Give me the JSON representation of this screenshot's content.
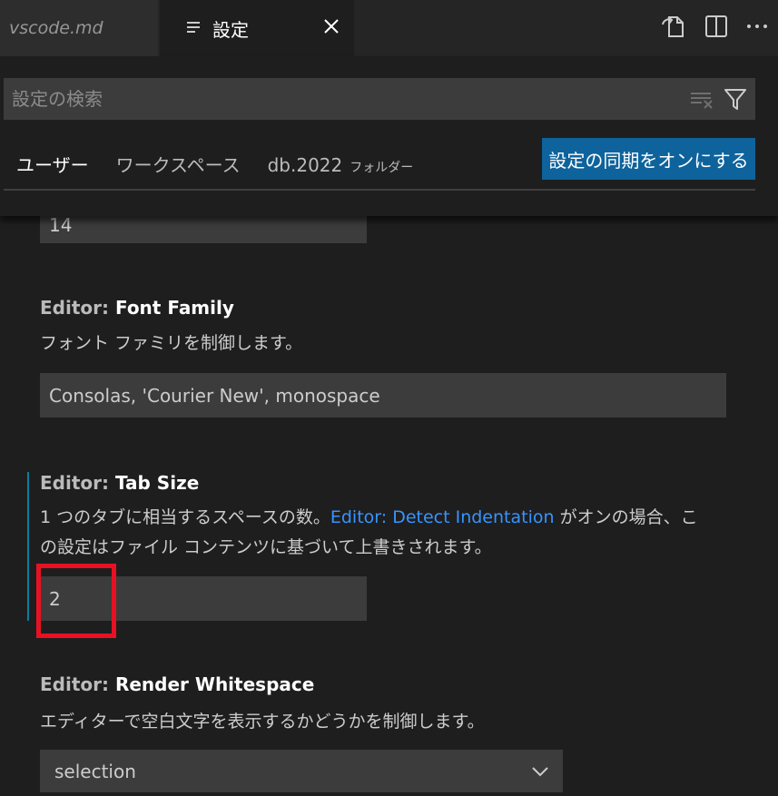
{
  "tabs": {
    "inactive_label": "vscode.md",
    "active_label": "設定",
    "close_glyph": "×"
  },
  "header": {
    "search_placeholder": "設定の検索",
    "scopes": {
      "user": "ユーザー",
      "workspace": "ワークスペース",
      "folder": "db.2022",
      "folder_hint": "フォルダー"
    },
    "sync_button": "設定の同期をオンにする"
  },
  "settings": {
    "font_size_value": "14",
    "font_family": {
      "category": "Editor: ",
      "name": "Font Family",
      "description": "フォント ファミリを制御します。",
      "value": "Consolas, 'Courier New', monospace"
    },
    "tab_size": {
      "category": "Editor: ",
      "name": "Tab Size",
      "description_pre": "1 つのタブに相当するスペースの数。",
      "link": "Editor: Detect Indentation",
      "description_post": " がオンの場合、こ",
      "description_line2": "の設定はファイル コンテンツに基づいて上書きされます。",
      "value": "2"
    },
    "render_whitespace": {
      "category": "Editor: ",
      "name": "Render Whitespace",
      "description": "エディターで空白文字を表示するかどうかを制御します。",
      "selected": "selection"
    }
  },
  "colors": {
    "accent": "#0e639c",
    "link": "#3794ff",
    "modified_indicator": "#0c7d9d",
    "highlight_box": "#e81123"
  },
  "icons": [
    "markdown-file-icon",
    "settings-lines-icon",
    "close-icon",
    "open-settings-json-icon",
    "split-editor-icon",
    "more-actions-icon",
    "clear-filter-icon",
    "filter-icon",
    "chevron-down-icon"
  ]
}
